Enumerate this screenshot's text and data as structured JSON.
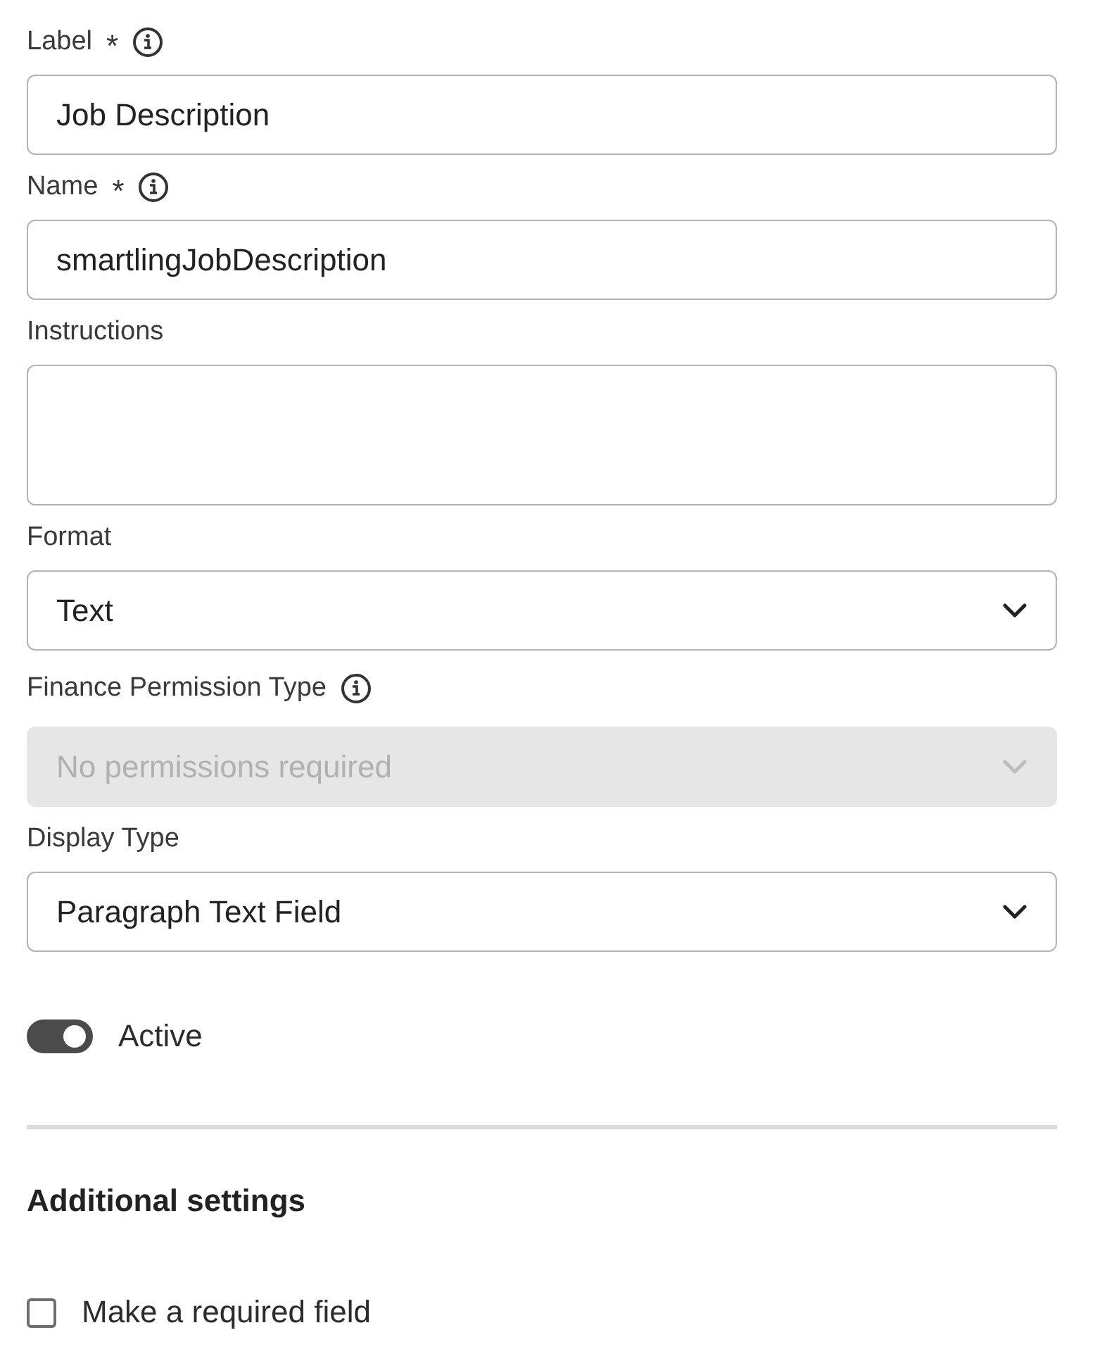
{
  "fields": [
    {
      "kind": "text",
      "label": "Label",
      "marker": "*",
      "info": true,
      "value": "Job Description"
    },
    {
      "kind": "text",
      "label": "Name",
      "marker": "*",
      "info": true,
      "value": "smartlingJobDescription"
    },
    {
      "kind": "textarea",
      "label": "Instructions",
      "info": false
    },
    {
      "kind": "select",
      "label": "Format",
      "info": false,
      "value": "Text",
      "disabled": false
    },
    {
      "kind": "select",
      "label": "Finance Permission Type",
      "info": true,
      "value": "No permissions required",
      "disabled": true
    },
    {
      "kind": "select",
      "label": "Display Type",
      "info": false,
      "value": "Paragraph Text Field",
      "disabled": false
    }
  ],
  "active_toggle": {
    "label": "Active",
    "on": true
  },
  "section_title": "Additional settings",
  "required_checkbox": {
    "label": "Make a required field",
    "checked": false
  }
}
